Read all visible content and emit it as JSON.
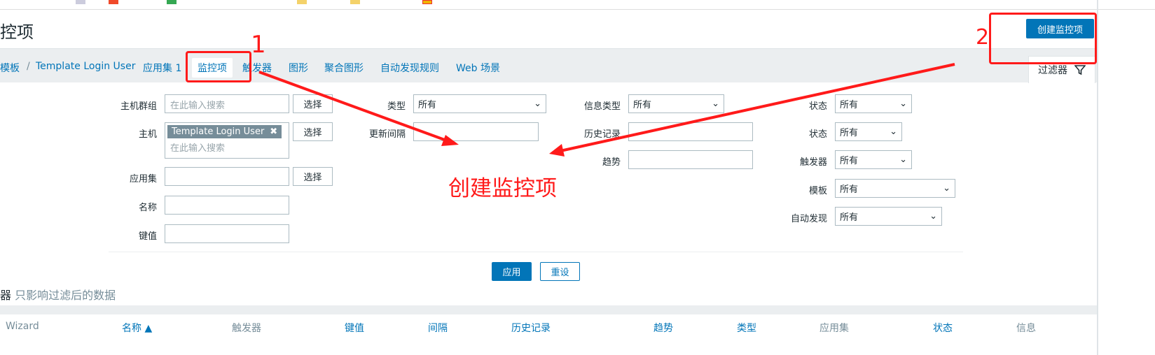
{
  "page": {
    "title": "控项",
    "create_button": "创建监控项"
  },
  "nav": {
    "breadcrumb_templates": "模板",
    "breadcrumb_sep": "/",
    "template": "Template Login User",
    "applications": "应用集 1",
    "items": "监控项",
    "triggers": "触发器",
    "graphs": "图形",
    "screens": "聚合图形",
    "discovery": "自动发现规则",
    "web": "Web 场景"
  },
  "filter": {
    "tab_label": "过滤器",
    "host_groups": {
      "label": "主机群组",
      "placeholder": "在此输入搜索",
      "select": "选择"
    },
    "hosts": {
      "label": "主机",
      "tag": "Template Login User",
      "placeholder": "在此输入搜索",
      "select": "选择"
    },
    "application": {
      "label": "应用集",
      "value": "",
      "select": "选择"
    },
    "name": {
      "label": "名称",
      "value": ""
    },
    "key": {
      "label": "键值",
      "value": ""
    },
    "type": {
      "label": "类型",
      "value": "所有"
    },
    "update_interval": {
      "label": "更新间隔",
      "value": ""
    },
    "info_type": {
      "label": "信息类型",
      "value": "所有"
    },
    "history": {
      "label": "历史记录",
      "value": ""
    },
    "trends": {
      "label": "趋势",
      "value": ""
    },
    "state": {
      "label": "状态",
      "value": "所有"
    },
    "status": {
      "label": "状态",
      "value": "所有"
    },
    "triggers": {
      "label": "触发器",
      "value": "所有"
    },
    "template": {
      "label": "模板",
      "value": "所有"
    },
    "discovery": {
      "label": "自动发现",
      "value": "所有"
    },
    "apply": "应用",
    "reset": "重设"
  },
  "mass_note": {
    "prefix": "器",
    "text": "只影响过滤后的数据"
  },
  "table": {
    "headers": [
      "Wizard",
      "名称 ▲",
      "触发器",
      "键值",
      "间隔",
      "历史记录",
      "趋势",
      "类型",
      "应用集",
      "状态",
      "信息"
    ]
  },
  "annotations": {
    "step1": "1",
    "step2": "2",
    "caption": "创建监控项",
    "color": "#ff1a1a"
  },
  "colors": {
    "accent": "#0275b8",
    "navbar": "#ebeef0"
  }
}
